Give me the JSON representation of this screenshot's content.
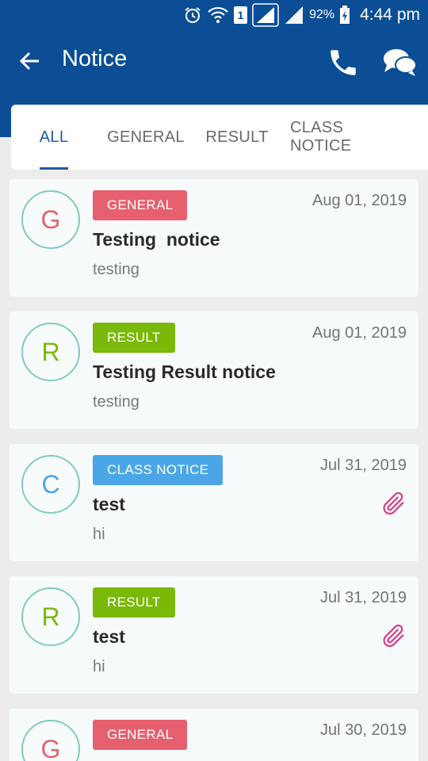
{
  "status_bar": {
    "battery": "92%",
    "sim": "1",
    "time": "4:44 pm"
  },
  "app_bar": {
    "title": "Notice"
  },
  "tabs": [
    {
      "label": "ALL",
      "active": true
    },
    {
      "label": "GENERAL",
      "active": false
    },
    {
      "label": "RESULT",
      "active": false
    },
    {
      "label": "CLASS NOTICE",
      "active": false
    }
  ],
  "colors": {
    "primary": "#0b4e96",
    "general": "#e6606f",
    "result": "#7ab80a",
    "class_notice": "#4aa6e6",
    "attachment": "#d6408a"
  },
  "notices": [
    {
      "initial": "G",
      "category": "GENERAL",
      "date": "Aug 01, 2019",
      "title": "Testing  notice",
      "description": "testing",
      "attachment": false
    },
    {
      "initial": "R",
      "category": "RESULT",
      "date": "Aug 01, 2019",
      "title": "Testing Result notice",
      "description": "testing",
      "attachment": false
    },
    {
      "initial": "C",
      "category": "CLASS NOTICE",
      "date": "Jul 31, 2019",
      "title": "test",
      "description": "hi",
      "attachment": true
    },
    {
      "initial": "R",
      "category": "RESULT",
      "date": "Jul 31, 2019",
      "title": "test",
      "description": "hi",
      "attachment": true
    },
    {
      "initial": "G",
      "category": "GENERAL",
      "date": "Jul 30, 2019",
      "title": "",
      "description": "",
      "attachment": false
    }
  ]
}
